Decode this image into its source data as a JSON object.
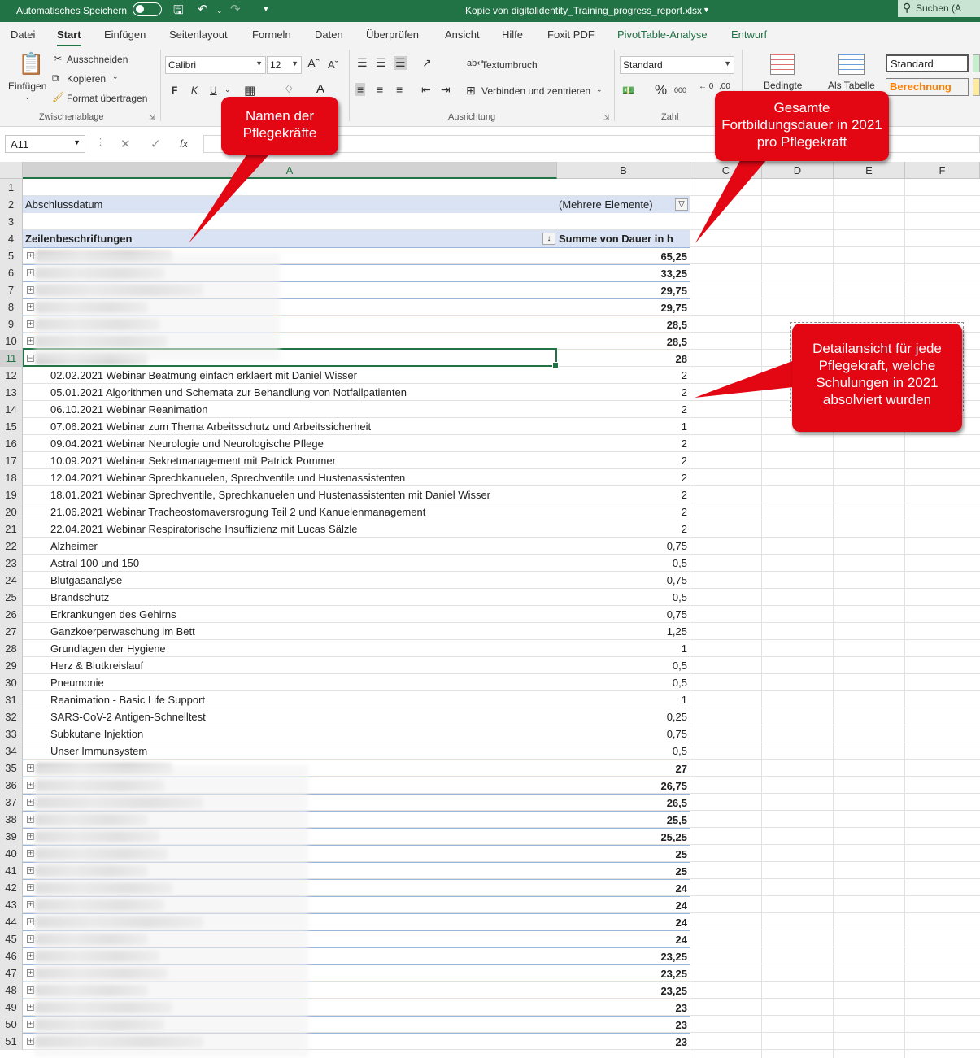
{
  "titlebar": {
    "autosave_label": "Automatisches Speichern",
    "filename": "Kopie von digitalidentity_Training_progress_report.xlsx",
    "search": "Suchen (A"
  },
  "menu": {
    "tabs": [
      "Datei",
      "Start",
      "Einfügen",
      "Seitenlayout",
      "Formeln",
      "Daten",
      "Überprüfen",
      "Ansicht",
      "Hilfe",
      "Foxit PDF",
      "PivotTable-Analyse",
      "Entwurf"
    ],
    "active": "Start"
  },
  "ribbon": {
    "paste": "Einfügen",
    "cut": "Ausschneiden",
    "copy": "Kopieren",
    "format_painter": "Format übertragen",
    "clipboard_group": "Zwischenablage",
    "font_name": "Calibri",
    "font_size": "12",
    "bold": "F",
    "italic": "K",
    "underline": "U",
    "wrap_text": "Textumbruch",
    "merge_center": "Verbinden und zentrieren",
    "alignment_group": "Ausrichtung",
    "number_format": "Standard",
    "number_group": "Zahl",
    "conditional": "Bedingte",
    "as_table": "Als Tabelle",
    "style_standard": "Standard",
    "style_calc": "Berechnung",
    "colors": {
      "accent": "#217346",
      "calc": "#fa7d00"
    }
  },
  "formula_bar": {
    "name_box": "A11",
    "fx": "fx"
  },
  "columns": [
    "A",
    "B",
    "C",
    "D",
    "E",
    "F"
  ],
  "sheet": {
    "filter_label": "Abschlussdatum",
    "filter_value": "(Mehrere Elemente)",
    "row_labels_header": "Zeilenbeschriftungen",
    "sum_header": "Summe von Dauer in h",
    "rows": [
      {
        "n": "1",
        "type": "empty",
        "a": "",
        "b": ""
      },
      {
        "n": "2",
        "type": "filter",
        "a": "Abschlussdatum",
        "b": "(Mehrere Elemente)"
      },
      {
        "n": "3",
        "type": "empty",
        "a": "",
        "b": ""
      },
      {
        "n": "4",
        "type": "header",
        "a": "Zeilenbeschriftungen",
        "b": "Summe von Dauer in h"
      },
      {
        "n": "5",
        "type": "group",
        "a": "",
        "b": "65,25"
      },
      {
        "n": "6",
        "type": "group",
        "a": "",
        "b": "33,25"
      },
      {
        "n": "7",
        "type": "group",
        "a": "",
        "b": "29,75"
      },
      {
        "n": "8",
        "type": "group",
        "a": "",
        "b": "29,75"
      },
      {
        "n": "9",
        "type": "group",
        "a": "",
        "b": "28,5"
      },
      {
        "n": "10",
        "type": "group",
        "a": "",
        "b": "28,5"
      },
      {
        "n": "11",
        "type": "group-open",
        "a": "",
        "b": "28"
      },
      {
        "n": "12",
        "type": "detail",
        "a": "02.02.2021 Webinar Beatmung einfach erklaert mit Daniel Wisser",
        "b": "2"
      },
      {
        "n": "13",
        "type": "detail",
        "a": "05.01.2021 Algorithmen und Schemata zur Behandlung von Notfallpatienten",
        "b": "2"
      },
      {
        "n": "14",
        "type": "detail",
        "a": "06.10.2021 Webinar Reanimation",
        "b": "2"
      },
      {
        "n": "15",
        "type": "detail",
        "a": "07.06.2021 Webinar zum Thema Arbeitsschutz und Arbeitssicherheit",
        "b": "1"
      },
      {
        "n": "16",
        "type": "detail",
        "a": "09.04.2021 Webinar Neurologie und Neurologische Pflege",
        "b": "2"
      },
      {
        "n": "17",
        "type": "detail",
        "a": "10.09.2021 Webinar Sekretmanagement mit Patrick Pommer",
        "b": "2"
      },
      {
        "n": "18",
        "type": "detail",
        "a": "12.04.2021 Webinar Sprechkanuelen, Sprechventile und Hustenassistenten",
        "b": "2"
      },
      {
        "n": "19",
        "type": "detail",
        "a": "18.01.2021 Webinar Sprechventile, Sprechkanuelen und Hustenassistenten mit Daniel Wisser",
        "b": "2"
      },
      {
        "n": "20",
        "type": "detail",
        "a": "21.06.2021 Webinar Tracheostomaversrogung Teil 2 und Kanuelenmanagement",
        "b": "2"
      },
      {
        "n": "21",
        "type": "detail",
        "a": "22.04.2021 Webinar Respiratorische Insuffizienz mit Lucas Sälzle",
        "b": "2"
      },
      {
        "n": "22",
        "type": "detail",
        "a": "Alzheimer",
        "b": "0,75"
      },
      {
        "n": "23",
        "type": "detail",
        "a": "Astral 100 und 150",
        "b": "0,5"
      },
      {
        "n": "24",
        "type": "detail",
        "a": "Blutgasanalyse",
        "b": "0,75"
      },
      {
        "n": "25",
        "type": "detail",
        "a": "Brandschutz",
        "b": "0,5"
      },
      {
        "n": "26",
        "type": "detail",
        "a": "Erkrankungen des Gehirns",
        "b": "0,75"
      },
      {
        "n": "27",
        "type": "detail",
        "a": "Ganzkoerperwaschung im Bett",
        "b": "1,25"
      },
      {
        "n": "28",
        "type": "detail",
        "a": "Grundlagen der Hygiene",
        "b": "1"
      },
      {
        "n": "29",
        "type": "detail",
        "a": "Herz & Blutkreislauf",
        "b": "0,5"
      },
      {
        "n": "30",
        "type": "detail",
        "a": "Pneumonie",
        "b": "0,5"
      },
      {
        "n": "31",
        "type": "detail",
        "a": "Reanimation - Basic Life Support",
        "b": "1"
      },
      {
        "n": "32",
        "type": "detail",
        "a": "SARS-CoV-2 Antigen-Schnelltest",
        "b": "0,25"
      },
      {
        "n": "33",
        "type": "detail",
        "a": "Subkutane Injektion",
        "b": "0,75"
      },
      {
        "n": "34",
        "type": "detail",
        "a": "Unser Immunsystem",
        "b": "0,5"
      },
      {
        "n": "35",
        "type": "group",
        "a": "",
        "b": "27"
      },
      {
        "n": "36",
        "type": "group",
        "a": "",
        "b": "26,75"
      },
      {
        "n": "37",
        "type": "group",
        "a": "",
        "b": "26,5"
      },
      {
        "n": "38",
        "type": "group",
        "a": "",
        "b": "25,5"
      },
      {
        "n": "39",
        "type": "group",
        "a": "",
        "b": "25,25"
      },
      {
        "n": "40",
        "type": "group",
        "a": "",
        "b": "25"
      },
      {
        "n": "41",
        "type": "group",
        "a": "",
        "b": "25"
      },
      {
        "n": "42",
        "type": "group",
        "a": "",
        "b": "24"
      },
      {
        "n": "43",
        "type": "group",
        "a": "",
        "b": "24"
      },
      {
        "n": "44",
        "type": "group",
        "a": "",
        "b": "24"
      },
      {
        "n": "45",
        "type": "group",
        "a": "",
        "b": "24"
      },
      {
        "n": "46",
        "type": "group",
        "a": "",
        "b": "23,25"
      },
      {
        "n": "47",
        "type": "group",
        "a": "",
        "b": "23,25"
      },
      {
        "n": "48",
        "type": "group",
        "a": "",
        "b": "23,25"
      },
      {
        "n": "49",
        "type": "group",
        "a": "",
        "b": "23"
      },
      {
        "n": "50",
        "type": "group",
        "a": "",
        "b": "23"
      },
      {
        "n": "51",
        "type": "group",
        "a": "",
        "b": "23"
      }
    ]
  },
  "callouts": {
    "names": "Namen der Pflegekräfte",
    "total": "Gesamte Fortbildungsdauer in 2021 pro Pflegekraft",
    "detail": "Detailansicht für jede Pflegekraft, welche Schulungen in 2021 absolviert wurden",
    "color": "#e30613"
  }
}
